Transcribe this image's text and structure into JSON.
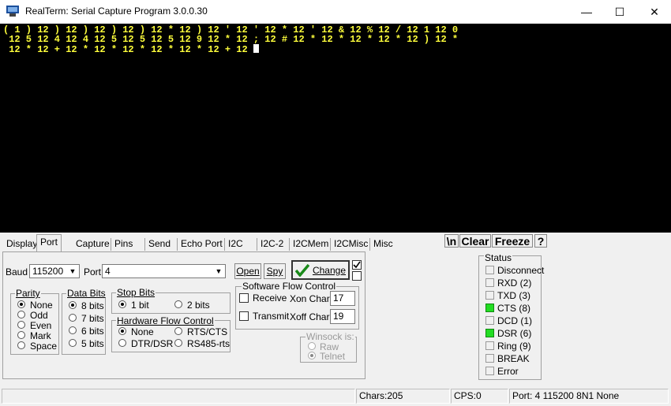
{
  "window": {
    "title": "RealTerm: Serial Capture Program 3.0.0.30",
    "minimize_glyph": "—",
    "maximize_glyph": "☐",
    "close_glyph": "✕"
  },
  "terminal": {
    "lines": [
      "( 1 ) 12 ) 12 ) 12 ) 12 ) 12 * 12 ) 12 ' 12 ' 12 * 12 ' 12 & 12 % 12 / 12 1 12 0",
      " 12 5 12 4 12 4 12 5 12 5 12 5 12 9 12 * 12 ; 12 # 12 * 12 * 12 * 12 * 12 ) 12 *",
      " 12 * 12 + 12 * 12 * 12 * 12 * 12 * 12 + 12 "
    ],
    "text_color": "#ffff3c",
    "bg_color": "#000000"
  },
  "tabs": [
    "Display",
    "Port",
    "Capture",
    "Pins",
    "Send",
    "Echo Port",
    "I2C",
    "I2C-2",
    "I2CMem",
    "I2CMisc",
    "Misc"
  ],
  "top_buttons": {
    "newline": "\\n",
    "clear": "Clear",
    "freeze": "Freeze",
    "help": "?"
  },
  "port": {
    "baud_label": "Baud",
    "baud_value": "115200",
    "port_label": "Port",
    "port_value": "4",
    "open_label": "Open",
    "spy_label": "Spy",
    "change_label": "Change"
  },
  "parity": {
    "title": "Parity",
    "options": [
      "None",
      "Odd",
      "Even",
      "Mark",
      "Space"
    ],
    "selected": 0
  },
  "data_bits": {
    "title": "Data Bits",
    "options": [
      "8 bits",
      "7 bits",
      "6 bits",
      "5 bits"
    ],
    "selected": 0
  },
  "stop_bits": {
    "title": "Stop Bits",
    "options": [
      "1 bit",
      "2 bits"
    ],
    "selected": 0
  },
  "hw_flow": {
    "title": "Hardware Flow Control",
    "options": [
      "None",
      "RTS/CTS",
      "DTR/DSR",
      "RS485-rts"
    ],
    "selected": 0
  },
  "sw_flow": {
    "title": "Software Flow Control",
    "receive_label": "Receive",
    "transmit_label": "Transmit",
    "xon_label": "Xon Char:",
    "xon_value": "17",
    "xoff_label": "Xoff Char:",
    "xoff_value": "19"
  },
  "winsock": {
    "title": "Winsock is:",
    "options": [
      "Raw",
      "Telnet"
    ],
    "selected": 1
  },
  "status": {
    "title": "Status",
    "items": [
      {
        "label": "Disconnect",
        "on": false
      },
      {
        "label": "RXD (2)",
        "on": false
      },
      {
        "label": "TXD (3)",
        "on": false
      },
      {
        "label": "CTS (8)",
        "on": true
      },
      {
        "label": "DCD (1)",
        "on": false
      },
      {
        "label": "DSR (6)",
        "on": true
      },
      {
        "label": "Ring (9)",
        "on": false
      },
      {
        "label": "BREAK",
        "on": false
      },
      {
        "label": "Error",
        "on": false
      }
    ],
    "led_on_color": "#22dd22"
  },
  "statusbar": {
    "chars": "Chars:205",
    "cps": "CPS:0",
    "port_info": "Port: 4  115200 8N1 None"
  }
}
